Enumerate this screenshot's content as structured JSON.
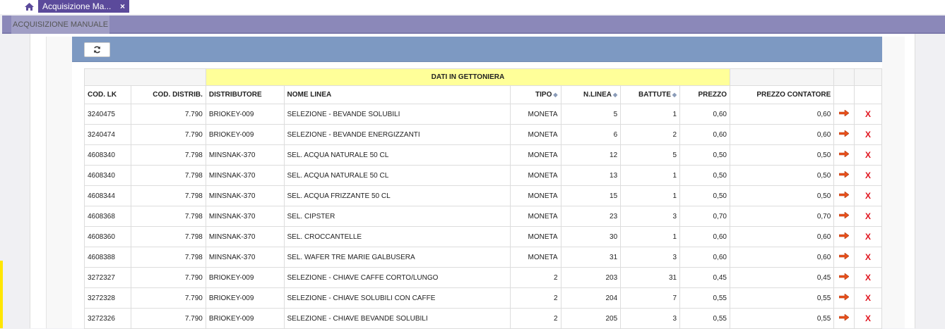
{
  "tabbar": {
    "tab_label": "Acquisizione Ma...",
    "close_glyph": "×"
  },
  "titlebar": {
    "label": "ACQUISIZIONE MANUALE"
  },
  "table": {
    "group_header": "DATI IN GETTONIERA",
    "columns": [
      "COD. LK",
      "COD. DISTRIB.",
      "DISTRIBUTORE",
      "NOME LINEA",
      "TIPO",
      "N.LINEA",
      "BATTUTE",
      "PREZZO",
      "PREZZO CONTATORE"
    ],
    "sortable": [
      "TIPO",
      "N.LINEA",
      "BATTUTE"
    ],
    "rows": [
      [
        "3240475",
        "7.790",
        "BRIOKEY-009",
        "SELEZIONE - BEVANDE SOLUBILI",
        "MONETA",
        "5",
        "1",
        "0,60",
        "0,60"
      ],
      [
        "3240474",
        "7.790",
        "BRIOKEY-009",
        "SELEZIONE - BEVANDE ENERGIZZANTI",
        "MONETA",
        "6",
        "2",
        "0,60",
        "0,60"
      ],
      [
        "4608340",
        "7.798",
        "MINSNAK-370",
        "SEL. ACQUA NATURALE 50 CL",
        "MONETA",
        "12",
        "5",
        "0,50",
        "0,50"
      ],
      [
        "4608340",
        "7.798",
        "MINSNAK-370",
        "SEL. ACQUA NATURALE 50 CL",
        "MONETA",
        "13",
        "1",
        "0,50",
        "0,50"
      ],
      [
        "4608344",
        "7.798",
        "MINSNAK-370",
        "SEL. ACQUA FRIZZANTE 50 CL",
        "MONETA",
        "15",
        "1",
        "0,50",
        "0,50"
      ],
      [
        "4608368",
        "7.798",
        "MINSNAK-370",
        "SEL. CIPSTER",
        "MONETA",
        "23",
        "3",
        "0,70",
        "0,70"
      ],
      [
        "4608360",
        "7.798",
        "MINSNAK-370",
        "SEL. CROCCANTELLE",
        "MONETA",
        "30",
        "1",
        "0,60",
        "0,60"
      ],
      [
        "4608388",
        "7.798",
        "MINSNAK-370",
        "SEL. WAFER TRE MARIE GALBUSERA",
        "MONETA",
        "31",
        "3",
        "0,60",
        "0,60"
      ],
      [
        "3272327",
        "7.790",
        "BRIOKEY-009",
        "SELEZIONE - CHIAVE CAFFE CORTO/LUNGO",
        "2",
        "203",
        "31",
        "0,45",
        "0,45"
      ],
      [
        "3272328",
        "7.790",
        "BRIOKEY-009",
        "SELEZIONE - CHIAVE SOLUBILI CON CAFFE",
        "2",
        "204",
        "7",
        "0,55",
        "0,55"
      ],
      [
        "3272326",
        "7.790",
        "BRIOKEY-009",
        "SELEZIONE - CHIAVE BEVANDE SOLUBILI",
        "2",
        "205",
        "3",
        "0,55",
        "0,55"
      ]
    ],
    "row_action_icons": [
      "arrow-right-icon",
      "delete-x-icon"
    ],
    "delete_glyph": "X"
  },
  "colors": {
    "tab": "#5b4a9b",
    "titlebar": "#8b88b9",
    "panel_head": "#7d99c2",
    "group_header": "#ffff99",
    "delete": "#e0141e",
    "arrow": "#e8501c"
  }
}
